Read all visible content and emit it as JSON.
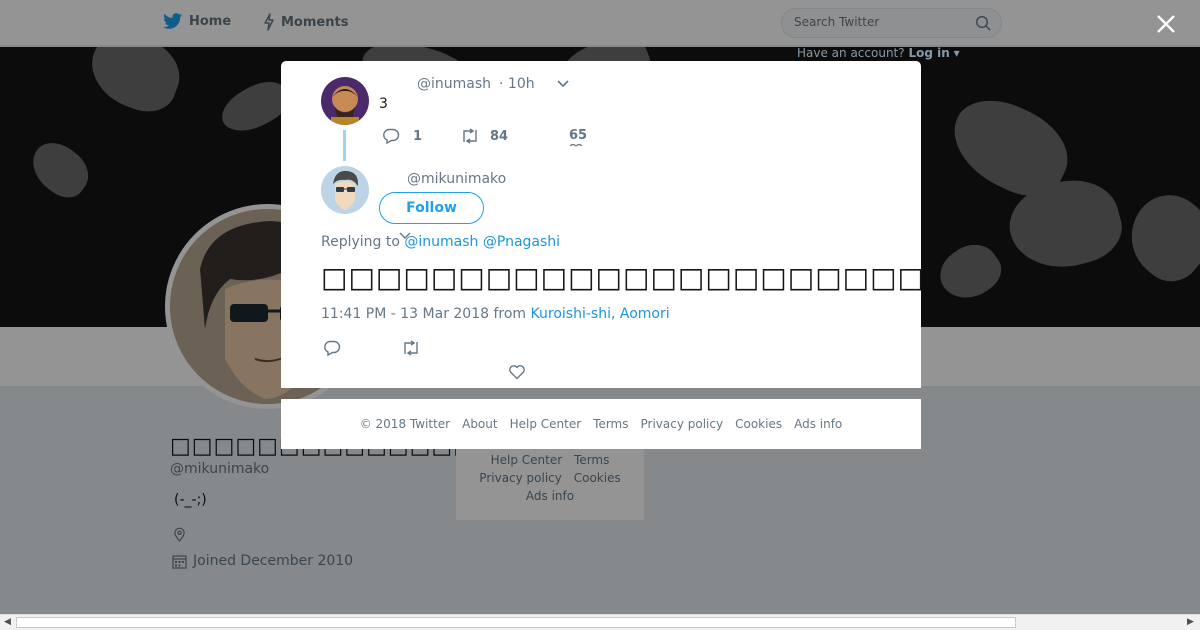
{
  "nav": {
    "home_label": "Home",
    "moments_label": "Moments",
    "search_placeholder": "Search Twitter",
    "have_account": "Have an account?",
    "login_label": "Log in"
  },
  "profile": {
    "display_name": "□□□□□□□□□□□□□□",
    "screen_name": "@mikunimako",
    "bio": "(-_-;)",
    "joined": "Joined December 2010"
  },
  "side_footer": {
    "help_center": "Help Center",
    "terms": "Terms",
    "privacy": "Privacy policy",
    "cookies": "Cookies",
    "ads_info": "Ads info"
  },
  "modal": {
    "parent_tweet": {
      "screen_name": "@inumash",
      "time": "· 10h",
      "text": "3",
      "reply_count": "1",
      "retweet_count": "84",
      "like_count": "65"
    },
    "main_tweet": {
      "screen_name": "@mikunimako",
      "follow_label": "Follow",
      "replying_label": "Replying to",
      "mention_1": "@inumash",
      "mention_2": "@Pnagashi",
      "text": "□□□□□□□□□□□□□□□□□□□□□□□□□□□□□□□□□□□□□□□□□□□□□□□□□□",
      "timestamp": "11:41 PM - 13 Mar 2018",
      "from_label": "from",
      "location": "Kuroishi-shi, Aomori"
    }
  },
  "footer": {
    "copyright": "© 2018 Twitter",
    "about": "About",
    "help_center": "Help Center",
    "terms": "Terms",
    "privacy": "Privacy policy",
    "cookies": "Cookies",
    "ads_info": "Ads info"
  },
  "colors": {
    "accent": "#1da1f2",
    "link": "#1b95e0",
    "muted": "#657786",
    "thread_line": "#a2d2f2"
  }
}
